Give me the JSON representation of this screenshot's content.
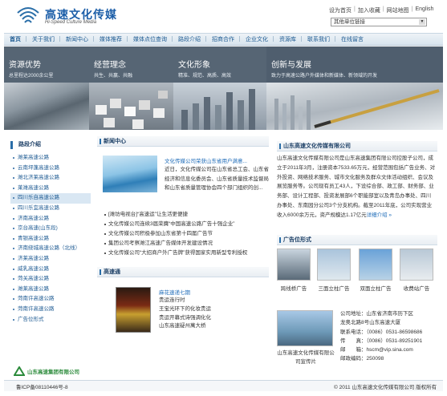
{
  "header": {
    "logo_cn": "高速文化传媒",
    "logo_en": "Hi-Speed Culture Media",
    "top_links": [
      "设为首页",
      "加入收藏",
      "网站地图",
      "English"
    ],
    "site_select": "其他单位链接"
  },
  "nav": [
    "首页",
    "关于我们",
    "新闻中心",
    "媒体推荐",
    "媒体点位查询",
    "路段介绍",
    "招商合作",
    "企业文化",
    "资源库",
    "联系我们",
    "在线留言"
  ],
  "banner": [
    {
      "title": "资源优势",
      "sub": "总里程达2000余公里"
    },
    {
      "title": "经营理念",
      "sub": "共生、共赢、共融"
    },
    {
      "title": "文化形象",
      "sub": "精准、规范、高质、高效"
    },
    {
      "title": "创新与发展",
      "sub": "致力于高速公路户外媒体和新媒体、新领域的开发"
    }
  ],
  "left": {
    "title": "路段介绍",
    "routes": [
      "潍莱高速公路",
      "云南坪蓬高速公路",
      "潍北济莱高速公路",
      "莱潍高速公路",
      "四川乐自高速公路",
      "四川乐宜高速公路",
      "济南高速公路",
      "京台高速(山东段)",
      "青银高速公路",
      "济南绕城高速公路（北线）",
      "济莱高速公路",
      "威乳高速公路",
      "菏关高速公路",
      "潍莱高速公路",
      "菏南许高速公路",
      "菏南许高速公路",
      "广告位形式"
    ],
    "highlight_index": 4,
    "logo_text": "山东高速集团有限公司"
  },
  "news": {
    "title": "新闻中心",
    "featured_title": "文化传媒公司荣获山东省用户满意...",
    "featured_body": "近日，文化传媒公司在山东省总工会、山东省经济和信息化委员会、山东省质量技术监督局和山东省质量管理协会四个部门组织的创...",
    "items": [
      "[潍坊电视台]“高速运”让生活更便捷",
      "文化传媒公司连续3届荣膺“中国高速公路广告十强企业”",
      "文化传媒公司积极参加山东省第十四届广告节",
      "集团公司考察潍江高速广告媒体开发建设情况",
      "文化传媒公司“大招商户外广告牌”获得国家实用新型专利授权"
    ]
  },
  "media": {
    "title": "高速通",
    "featured_title": "麻花速递七期",
    "items": [
      "贵运连行时",
      "王宝光环下的化妆贵运",
      "贵运开幕式诗强调化化",
      "山东高速疑州萬大桥"
    ]
  },
  "about": {
    "title": "山东高速文化传媒有限公司",
    "body": "山东高速文化传媒有限公司是山东高速集团有限公司控股子公司，成立于2011年3月，注册资本7533.65万元，经营范围包括广告业务、对外投资、网络技术服务、城市文化服务及群众文体活动组织、会议及展览服务等。公司现有员工43人，下设综合部、政工部、财务部、业务部、设计工程部、投资发展部6个职能部室以及青岛办事处、四川办事处、东南园分公司3个分支机构。截至2011年底，公司实现营业收入6000余万元，资产规模达1.17亿元",
    "more": "详细介绍 »"
  },
  "ads": {
    "title": "广告位形式",
    "items": [
      "跨线桥广告",
      "三面立柱广告",
      "双面立柱广告",
      "收费站广告"
    ]
  },
  "contact": {
    "image_caption": "山东高速文化传媒有限公司宣传片",
    "lines": [
      "公司地址：山东省济南市历下区",
      "龙奥北路8号山东高速大厦",
      "联系电话：（0086）0531-86598686",
      "传　　真：（0086）0531-89251901",
      "邮　　箱：hscm@vip.sina.com",
      "邮政编码：250098"
    ]
  },
  "footer": {
    "icp": "鲁ICP备08110446号-8",
    "copyright": "© 2011 山东高速文化传媒有限公司 版权所有"
  }
}
